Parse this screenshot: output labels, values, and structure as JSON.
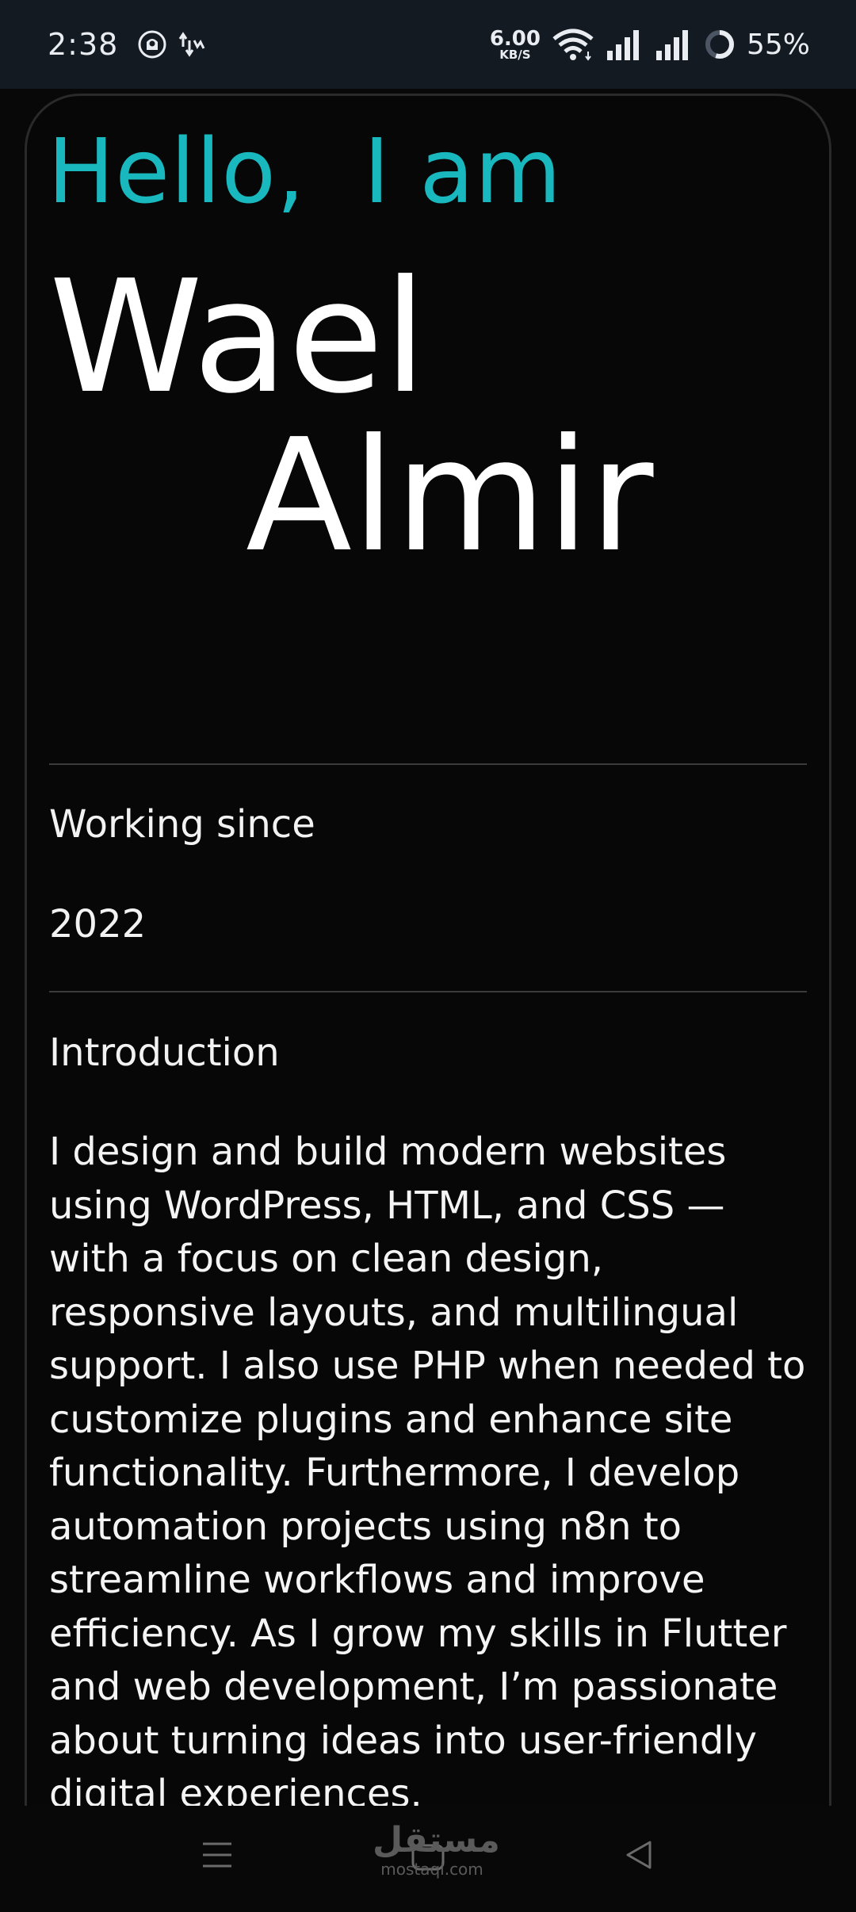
{
  "status_bar": {
    "time": "2:38",
    "net_speed_value": "6.00",
    "net_speed_unit": "KB/S",
    "battery_percent": "55%",
    "battery_level": 0.55,
    "icons": [
      "app-notification-icon",
      "data-transfer-icon",
      "wifi-icon",
      "cellular-signal-icon",
      "cellular-signal-icon",
      "battery-ring-icon"
    ]
  },
  "profile": {
    "greeting": "Hello,  I am",
    "first_name": "Wael",
    "last_name": "Almir"
  },
  "details": {
    "working_since_label": "Working since",
    "working_since_value": "2022",
    "introduction_label": "Introduction",
    "introduction_text": "I design and build modern websites using WordPress,  HTML,  and CSS — with a focus on clean design,  responsive layouts,  and multilingual support.  I also use PHP when needed to customize plugins and enhance site functionality.  Furthermore,  I develop automation projects using n8n to streamline workflows and improve efficiency.  As I grow my skills in Flutter and web development,  I’m passionate about turning ideas into user-friendly digital experiences."
  },
  "watermark": {
    "arabic": "مستقل",
    "latin": "mostaql.com"
  },
  "colors": {
    "accent": "#19b8be",
    "background": "#080808",
    "status_bar": "#141a22",
    "text": "#ffffff"
  }
}
